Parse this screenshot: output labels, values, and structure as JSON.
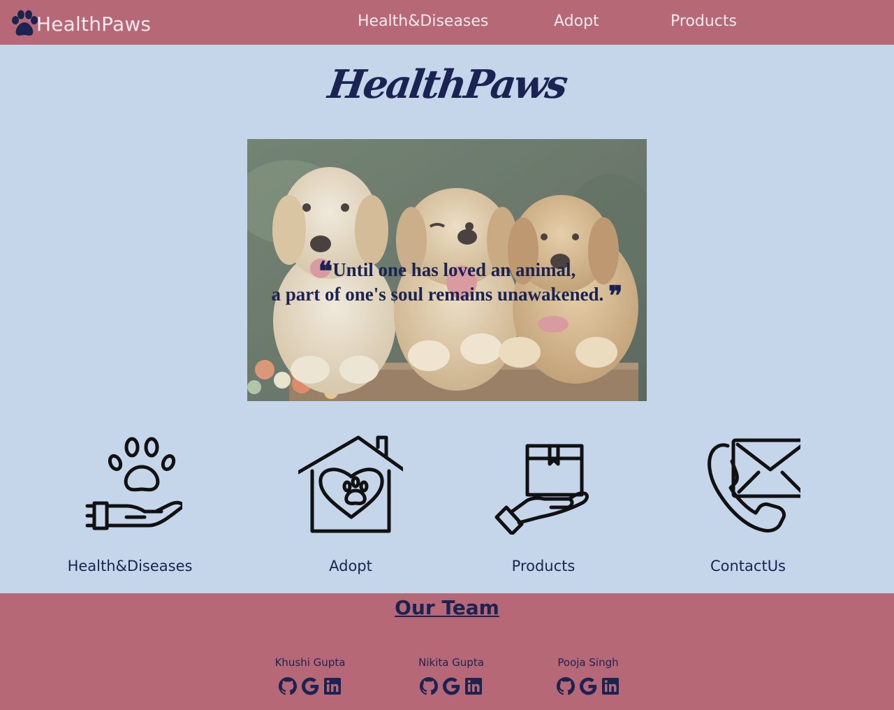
{
  "navbar": {
    "brand_icon": "paw-icon",
    "brand": "HealthPaws",
    "links": [
      "Health&Diseases",
      "Adopt",
      "Products"
    ]
  },
  "hero": {
    "title": "HealthPaws",
    "quote_line1": "Until one has loved an animal,",
    "quote_line2": "a part of one's soul remains unawakened.",
    "image": "three golden retriever puppies"
  },
  "features": [
    {
      "icon": "paw-in-hand-icon",
      "label": "Health&Diseases"
    },
    {
      "icon": "heart-house-icon",
      "label": "Adopt"
    },
    {
      "icon": "box-in-hand-icon",
      "label": "Products"
    },
    {
      "icon": "phone-envelope-icon",
      "label": "ContactUs"
    }
  ],
  "footer": {
    "title": "Our Team",
    "members": [
      {
        "name": "Khushi Gupta",
        "links": [
          "github-icon",
          "google-icon",
          "linkedin-icon"
        ]
      },
      {
        "name": "Nikita Gupta",
        "links": [
          "github-icon",
          "google-icon",
          "linkedin-icon"
        ]
      },
      {
        "name": "Pooja Singh",
        "links": [
          "github-icon",
          "google-icon",
          "linkedin-icon"
        ]
      }
    ]
  },
  "colors": {
    "navbar": "#b76877",
    "background": "#c5d5ea",
    "text": "#1a2352",
    "nav_text": "#f3e8ee"
  }
}
